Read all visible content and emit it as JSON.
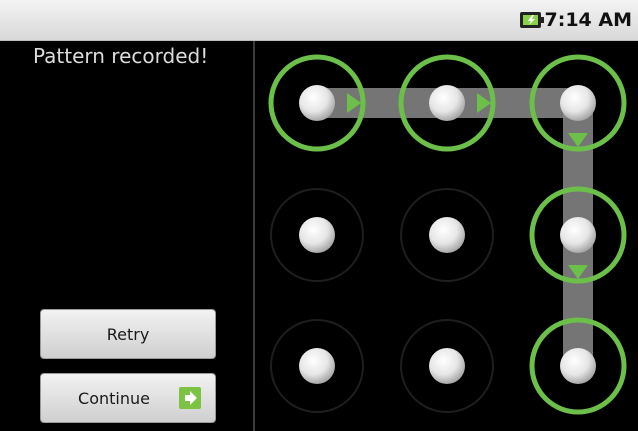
{
  "status_bar": {
    "time": "7:14 AM",
    "battery_icon": "battery-charging-icon"
  },
  "header": {
    "message": "Pattern recorded!"
  },
  "buttons": {
    "retry_label": "Retry",
    "continue_label": "Continue",
    "continue_icon": "arrow-right-icon"
  },
  "pattern": {
    "grid_size": 3,
    "sequence": [
      1,
      2,
      3,
      6,
      9
    ],
    "accent_color": "#6cc04a"
  }
}
